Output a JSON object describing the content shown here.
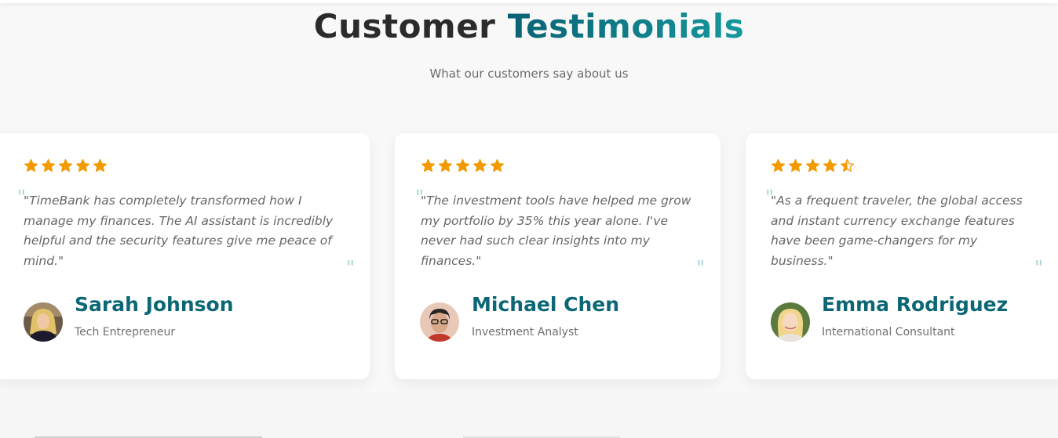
{
  "header": {
    "title_part1": "Customer",
    "title_part2": "Testimonials",
    "subtitle": "What our customers say about us"
  },
  "colors": {
    "accent": "#0b6774",
    "star": "#f29a00",
    "quote_mark": "#a9d4d8"
  },
  "testimonials": [
    {
      "rating": 5,
      "quote": "\"TimeBank has completely transformed how I manage my finances. The AI assistant is incredibly helpful and the security features give me peace of mind.\"",
      "name": "Sarah Johnson",
      "role": "Tech Entrepreneur",
      "avatar_icon": "woman-avatar"
    },
    {
      "rating": 5,
      "quote": "\"The investment tools have helped me grow my portfolio by 35% this year alone. I've never had such clear insights into my finances.\"",
      "name": "Michael Chen",
      "role": "Investment Analyst",
      "avatar_icon": "man-avatar"
    },
    {
      "rating": 4.5,
      "quote": "\"As a frequent traveler, the global access and instant currency exchange features have been game-changers for my business.\"",
      "name": "Emma Rodriguez",
      "role": "International Consultant",
      "avatar_icon": "woman-avatar"
    }
  ]
}
